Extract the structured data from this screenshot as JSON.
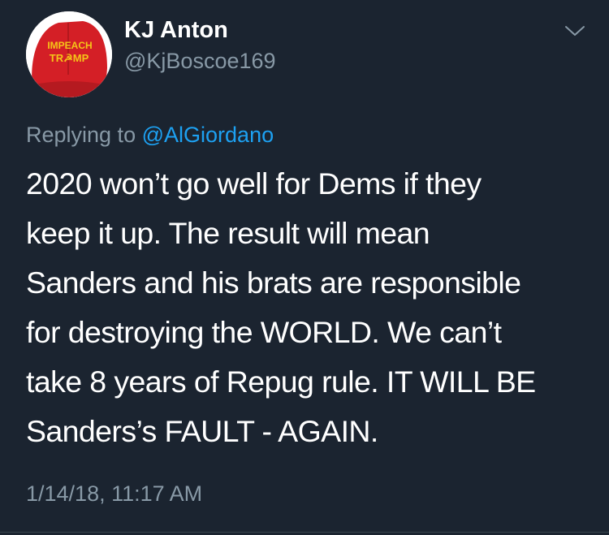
{
  "author": {
    "display_name": "KJ Anton",
    "handle": "@KjBoscoe169",
    "avatar": {
      "icon": "red-cap-avatar",
      "cap_text_line1": "IMPEACH",
      "cap_text_line2": "TR☭MP"
    }
  },
  "menu": {
    "icon": "chevron-down-icon"
  },
  "reply": {
    "prefix": "Replying to",
    "mention": "@AlGiordano"
  },
  "tweet": {
    "lines": [
      "2020 won’t go well for Dems if they",
      "keep it up. The result will mean",
      "Sanders and his brats are responsible",
      "for destroying the WORLD. We can’t",
      "take 8 years of Repug rule. IT WILL BE",
      "Sanders’s FAULT - AGAIN."
    ],
    "timestamp": "1/14/18, 11:17 AM"
  },
  "colors": {
    "background": "#1b2430",
    "text": "#ffffff",
    "secondary": "#8899a6",
    "link": "#1da1f2",
    "cap_red": "#d41f26",
    "cap_text": "#f5c518"
  }
}
